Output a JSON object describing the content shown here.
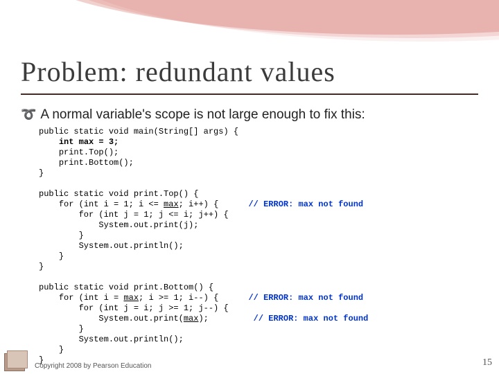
{
  "title": "Problem: redundant values",
  "bullet": "A normal variable's scope is not large enough to fix this:",
  "code": {
    "main_sig": "public static void main(String[] args) {",
    "main_decl_kw": "int max = 3;",
    "main_l2": "print.Top();",
    "main_l3": "print.Bottom();",
    "close": "}",
    "top_sig": "public static void print.Top() {",
    "top_for1a": "for (int i = 1; i <= ",
    "top_for1_mid": "max",
    "top_for1b": "; i++) {",
    "err": "// ERROR: max not found",
    "top_for2": "for (int j = 1; j <= i; j++) {",
    "top_print": "System.out.print(j);",
    "top_println": "System.out.println();",
    "bot_sig": "public static void print.Bottom() {",
    "bot_for1a": "for (int i = ",
    "bot_for1b": "; i >= 1; i--) {",
    "bot_for2": "for (int j = i; j >= 1; j--) {",
    "bot_print_a": "System.out.print(",
    "bot_print_b": ");",
    "bot_println": "System.out.println();"
  },
  "page_number": "15",
  "copyright": "Copyright 2008 by Pearson Education"
}
